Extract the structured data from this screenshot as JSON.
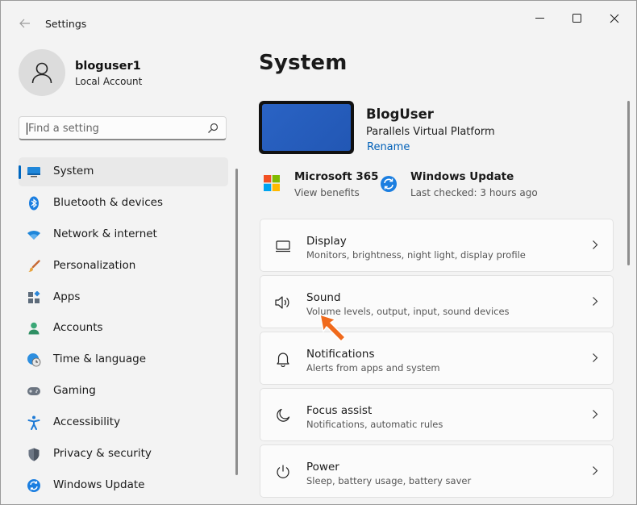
{
  "window": {
    "app_title": "Settings",
    "back_icon": "back-arrow-icon",
    "controls": [
      "minimize-icon",
      "maximize-icon",
      "close-icon"
    ]
  },
  "user": {
    "name": "bloguser1",
    "account_type": "Local Account"
  },
  "search": {
    "placeholder": "Find a setting"
  },
  "sidebar": {
    "items": [
      {
        "label": "System",
        "icon": "monitor-icon",
        "active": true
      },
      {
        "label": "Bluetooth & devices",
        "icon": "bluetooth-icon",
        "active": false
      },
      {
        "label": "Network & internet",
        "icon": "wifi-icon",
        "active": false
      },
      {
        "label": "Personalization",
        "icon": "paintbrush-icon",
        "active": false
      },
      {
        "label": "Apps",
        "icon": "apps-icon",
        "active": false
      },
      {
        "label": "Accounts",
        "icon": "person-icon",
        "active": false
      },
      {
        "label": "Time & language",
        "icon": "globe-clock-icon",
        "active": false
      },
      {
        "label": "Gaming",
        "icon": "gamepad-icon",
        "active": false
      },
      {
        "label": "Accessibility",
        "icon": "accessibility-icon",
        "active": false
      },
      {
        "label": "Privacy & security",
        "icon": "shield-icon",
        "active": false
      },
      {
        "label": "Windows Update",
        "icon": "update-icon",
        "active": false
      }
    ]
  },
  "main": {
    "title": "System",
    "device": {
      "name": "BlogUser",
      "platform": "Parallels Virtual Platform",
      "rename_label": "Rename"
    },
    "quick_links": [
      {
        "title": "Microsoft 365",
        "subtitle": "View benefits",
        "icon": "microsoft-logo-icon"
      },
      {
        "title": "Windows Update",
        "subtitle": "Last checked: 3 hours ago",
        "icon": "sync-icon"
      }
    ],
    "cards": [
      {
        "title": "Display",
        "subtitle": "Monitors, brightness, night light, display profile",
        "icon": "display-icon"
      },
      {
        "title": "Sound",
        "subtitle": "Volume levels, output, input, sound devices",
        "icon": "speaker-icon"
      },
      {
        "title": "Notifications",
        "subtitle": "Alerts from apps and system",
        "icon": "bell-icon"
      },
      {
        "title": "Focus assist",
        "subtitle": "Notifications, automatic rules",
        "icon": "moon-icon"
      },
      {
        "title": "Power",
        "subtitle": "Sleep, battery usage, battery saver",
        "icon": "power-icon"
      }
    ]
  },
  "colors": {
    "accent": "#0067c0",
    "annotation_arrow": "#f06a1c",
    "background": "#f3f3f3"
  }
}
